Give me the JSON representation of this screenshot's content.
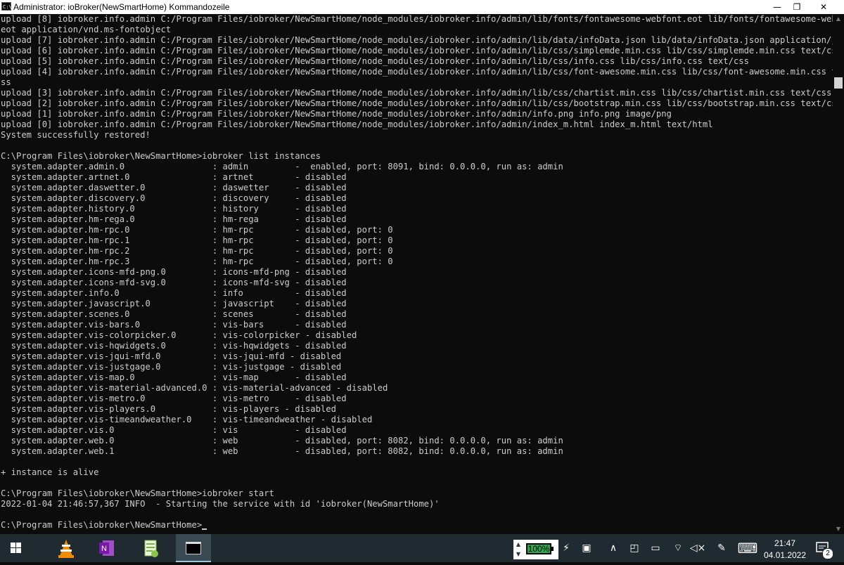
{
  "window": {
    "title": "Administrator: ioBroker(NewSmartHome) Kommandozeile",
    "icon_text": "C:\\.",
    "minimize_glyph": "—",
    "maximize_glyph": "❐",
    "close_glyph": "✕"
  },
  "console": {
    "lines": [
      "upload [8] iobroker.info.admin C:/Program Files/iobroker/NewSmartHome/node_modules/iobroker.info/admin/lib/fonts/fontawesome-webfont.eot lib/fonts/fontawesome-webfont.",
      "eot application/vnd.ms-fontobject",
      "upload [7] iobroker.info.admin C:/Program Files/iobroker/NewSmartHome/node_modules/iobroker.info/admin/lib/data/infoData.json lib/data/infoData.json application/json",
      "upload [6] iobroker.info.admin C:/Program Files/iobroker/NewSmartHome/node_modules/iobroker.info/admin/lib/css/simplemde.min.css lib/css/simplemde.min.css text/css",
      "upload [5] iobroker.info.admin C:/Program Files/iobroker/NewSmartHome/node_modules/iobroker.info/admin/lib/css/info.css lib/css/info.css text/css",
      "upload [4] iobroker.info.admin C:/Program Files/iobroker/NewSmartHome/node_modules/iobroker.info/admin/lib/css/font-awesome.min.css lib/css/font-awesome.min.css text/c",
      "ss",
      "upload [3] iobroker.info.admin C:/Program Files/iobroker/NewSmartHome/node_modules/iobroker.info/admin/lib/css/chartist.min.css lib/css/chartist.min.css text/css",
      "upload [2] iobroker.info.admin C:/Program Files/iobroker/NewSmartHome/node_modules/iobroker.info/admin/lib/css/bootstrap.min.css lib/css/bootstrap.min.css text/css",
      "upload [1] iobroker.info.admin C:/Program Files/iobroker/NewSmartHome/node_modules/iobroker.info/admin/info.png info.png image/png",
      "upload [0] iobroker.info.admin C:/Program Files/iobroker/NewSmartHome/node_modules/iobroker.info/admin/index_m.html index_m.html text/html",
      "System successfully restored!",
      "",
      "C:\\Program Files\\iobroker\\NewSmartHome>iobroker list instances",
      "  system.adapter.admin.0                 : admin         -  enabled, port: 8091, bind: 0.0.0.0, run as: admin",
      "  system.adapter.artnet.0                : artnet        - disabled",
      "  system.adapter.daswetter.0             : daswetter     - disabled",
      "  system.adapter.discovery.0             : discovery     - disabled",
      "  system.adapter.history.0               : history       - disabled",
      "  system.adapter.hm-rega.0               : hm-rega       - disabled",
      "  system.adapter.hm-rpc.0                : hm-rpc        - disabled, port: 0",
      "  system.adapter.hm-rpc.1                : hm-rpc        - disabled, port: 0",
      "  system.adapter.hm-rpc.2                : hm-rpc        - disabled, port: 0",
      "  system.adapter.hm-rpc.3                : hm-rpc        - disabled, port: 0",
      "  system.adapter.icons-mfd-png.0         : icons-mfd-png - disabled",
      "  system.adapter.icons-mfd-svg.0         : icons-mfd-svg - disabled",
      "  system.adapter.info.0                  : info          - disabled",
      "  system.adapter.javascript.0            : javascript    - disabled",
      "  system.adapter.scenes.0                : scenes        - disabled",
      "  system.adapter.vis-bars.0              : vis-bars      - disabled",
      "  system.adapter.vis-colorpicker.0       : vis-colorpicker - disabled",
      "  system.adapter.vis-hqwidgets.0         : vis-hqwidgets - disabled",
      "  system.adapter.vis-jqui-mfd.0          : vis-jqui-mfd - disabled",
      "  system.adapter.vis-justgage.0          : vis-justgage - disabled",
      "  system.adapter.vis-map.0               : vis-map       - disabled",
      "  system.adapter.vis-material-advanced.0 : vis-material-advanced - disabled",
      "  system.adapter.vis-metro.0             : vis-metro     - disabled",
      "  system.adapter.vis-players.0           : vis-players - disabled",
      "  system.adapter.vis-timeandweather.0    : vis-timeandweather - disabled",
      "  system.adapter.vis.0                   : vis           - disabled",
      "  system.adapter.web.0                   : web           - disabled, port: 8082, bind: 0.0.0.0, run as: admin",
      "  system.adapter.web.1                   : web           - disabled, port: 8082, bind: 0.0.0.0, run as: admin",
      "",
      "+ instance is alive",
      "",
      "C:\\Program Files\\iobroker\\NewSmartHome>iobroker start",
      "2022-01-04 21:46:57,367 INFO  - Starting the service with id 'iobroker(NewSmartHome)'",
      "",
      "C:\\Program Files\\iobroker\\NewSmartHome>"
    ]
  },
  "scrollbar": {
    "up_glyph": "▲",
    "down_glyph": "▼"
  },
  "taskbar": {
    "start_icon": "windows-logo-icon",
    "pinned": [
      {
        "name": "vlc-icon"
      },
      {
        "name": "onenote-icon",
        "letter": "N"
      },
      {
        "name": "notepad-plus-icon"
      },
      {
        "name": "cmd-icon"
      }
    ],
    "battery": {
      "percent_text": "100%",
      "percent": 100,
      "up_glyph": "▲",
      "down_glyph": "▼",
      "fill_color": "#2ea84f"
    },
    "tray_glyphs": {
      "plug": "⚡",
      "display": "▣",
      "chevron": "∧",
      "meet": "◰",
      "battery": "▭",
      "wifi": "⌔",
      "volume": "◁×",
      "pen": "✎",
      "keyboard": "⌨"
    },
    "clock": {
      "time": "21:47",
      "date": "04.01.2022"
    },
    "notifications": {
      "count": "2",
      "glyph": "▭"
    }
  },
  "colors": {
    "console_bg": "#0c0c0c",
    "console_fg": "#cccccc",
    "taskbar_bg": "#1f2b30"
  }
}
